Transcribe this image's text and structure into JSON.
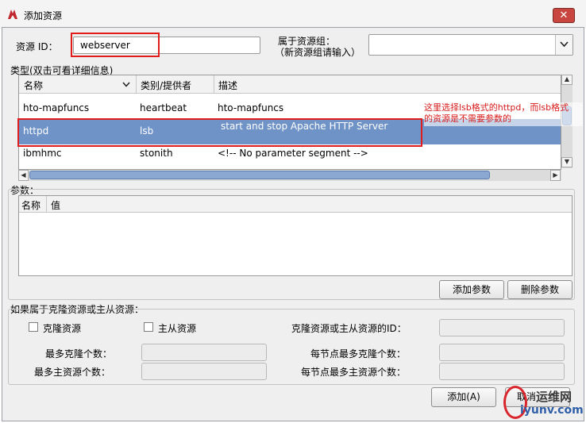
{
  "window": {
    "title": "添加资源",
    "close_glyph": "✕"
  },
  "resource_id": {
    "label": "资源 ID：",
    "value": "webserver"
  },
  "group": {
    "label_line1": "属于资源组：",
    "label_line2": "（新资源组请输入）",
    "value": ""
  },
  "types": {
    "section_label": "类型(双击可看详细信息)",
    "columns": [
      "名称",
      "类别/提供者",
      "描述"
    ],
    "rows": [
      {
        "name": "hto-mapfuncs",
        "provider": "heartbeat",
        "desc": "hto-mapfuncs"
      },
      {
        "name": "httpd",
        "provider": "lsb",
        "desc": "start and stop Apache HTTP Server"
      },
      {
        "name": "ibmhmc",
        "provider": "stonith",
        "desc": "<!-- No parameter segment -->"
      }
    ],
    "selected_index": 1,
    "annotation_line1": "这里选择lsb格式的httpd，而lsb格式",
    "annotation_line2": "的资源是不需要参数的"
  },
  "params": {
    "section_label": "参数：",
    "columns": [
      "名称",
      "值"
    ],
    "add_button": "添加参数",
    "delete_button": "删除参数"
  },
  "clone": {
    "section_label": "如果属于克隆资源或主从资源：",
    "clone_checkbox": "克隆资源",
    "master_checkbox": "主从资源",
    "clone_id_label": "克隆资源或主从资源的ID：",
    "max_clones_label": "最多克隆个数：",
    "max_master_label": "最多主资源个数：",
    "node_max_clones_label": "每节点最多克隆个数：",
    "node_max_master_label": "每节点最多主资源个数："
  },
  "footer": {
    "add_button": "添加(A)",
    "cancel_button": "取消"
  },
  "watermark": {
    "text_top": "运维网",
    "text_bottom": "iyunv.com"
  },
  "colors": {
    "selection": "#6f93c6",
    "annotation": "#d81b1b",
    "highlight_box": "#e21b1b"
  }
}
